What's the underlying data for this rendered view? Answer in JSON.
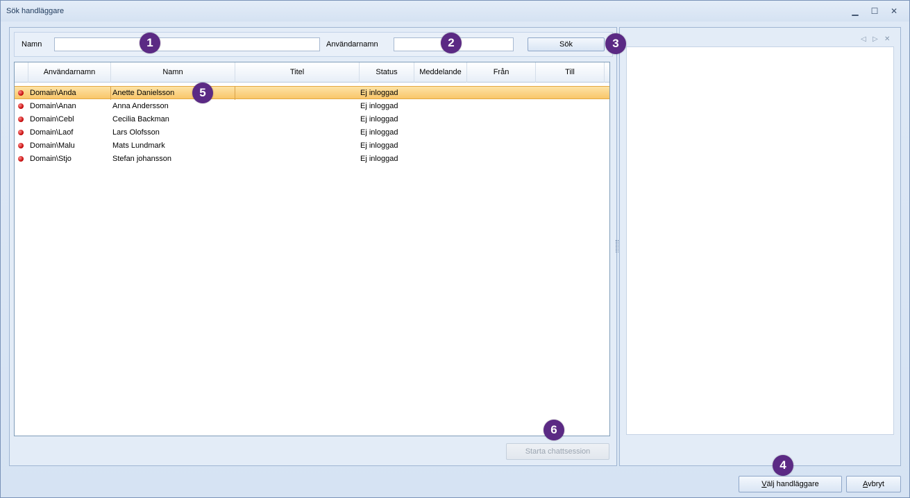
{
  "window": {
    "title": "Sök handläggare",
    "controls": {
      "minimize": "▁",
      "maximize": "☐",
      "close": "✕"
    }
  },
  "search": {
    "name_label": "Namn",
    "name_value": "",
    "username_label": "Användarnamn",
    "username_value": "",
    "search_button": "Sök"
  },
  "grid": {
    "columns": [
      "Användarnamn",
      "Namn",
      "Titel",
      "Status",
      "Meddelande",
      "Från",
      "Till"
    ],
    "rows": [
      {
        "username": "Domain\\Anda",
        "name": "Anette Danielsson",
        "title": "",
        "status": "Ej inloggad",
        "selected": true
      },
      {
        "username": "Domain\\Anan",
        "name": "Anna Andersson",
        "title": "",
        "status": "Ej inloggad"
      },
      {
        "username": "Domain\\Cebl",
        "name": "Cecilia Backman",
        "title": "",
        "status": "Ej inloggad"
      },
      {
        "username": "Domain\\Laof",
        "name": "Lars Olofsson",
        "title": "",
        "status": "Ej inloggad"
      },
      {
        "username": "Domain\\Malu",
        "name": "Mats Lundmark",
        "title": "",
        "status": "Ej inloggad"
      },
      {
        "username": "Domain\\Stjo",
        "name": "Stefan johansson",
        "title": "",
        "status": "Ej inloggad"
      }
    ],
    "status_dot_color": "#c00000",
    "selected_row_color": "#f9c66a"
  },
  "chat": {
    "start_button": "Starta chattsession"
  },
  "footer": {
    "select_button": "Välj handläggare",
    "cancel_button": "Avbryt"
  },
  "right_panel": {
    "nav_prev": "◁",
    "nav_next": "▷",
    "nav_close": "✕"
  },
  "badges": [
    "1",
    "2",
    "3",
    "4",
    "5",
    "6"
  ],
  "badge_color": "#5b2a84"
}
